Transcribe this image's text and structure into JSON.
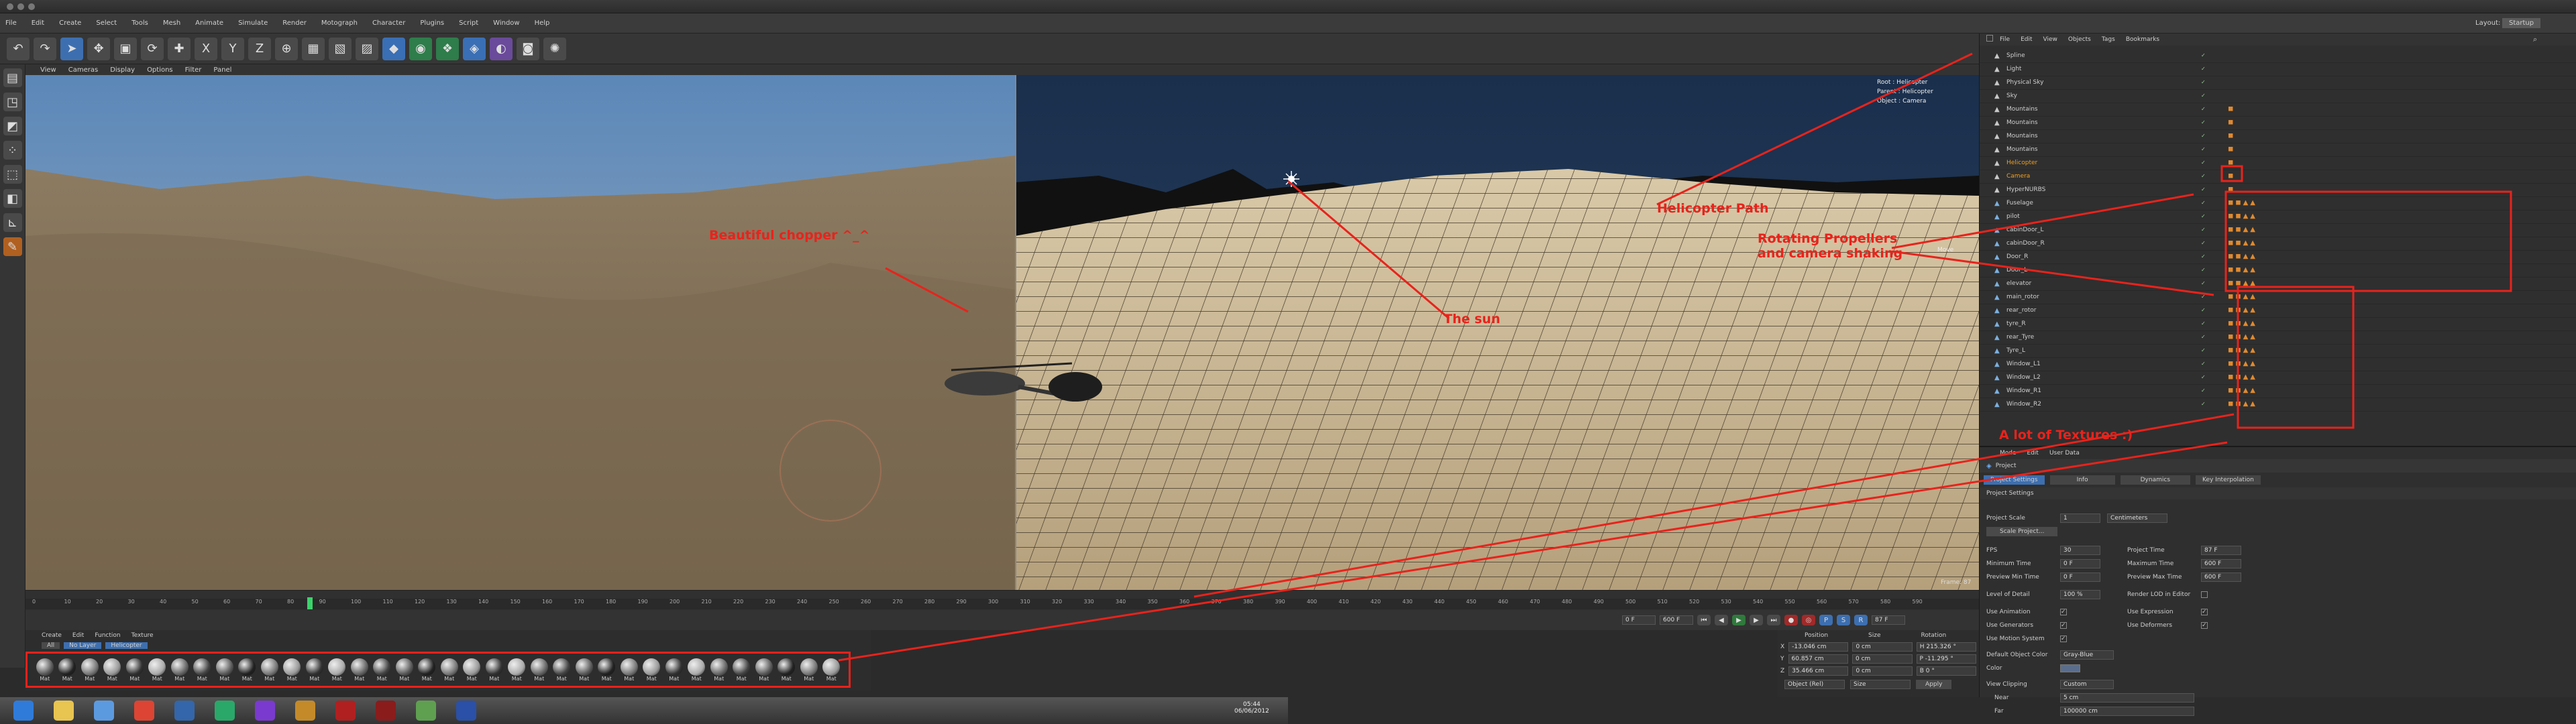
{
  "app": {
    "menu": [
      "File",
      "Edit",
      "Create",
      "Select",
      "Tools",
      "Mesh",
      "Animate",
      "Simulate",
      "Render",
      "Motograph",
      "Character",
      "Plugins",
      "Script",
      "Window",
      "Help"
    ],
    "layout_label": "Layout:",
    "layout_value": "Startup"
  },
  "viewport": {
    "menu": [
      "View",
      "Cameras",
      "Display",
      "Options",
      "Filter",
      "Panel"
    ],
    "hud": [
      "Root : Helicopter",
      "Parent : Helicopter",
      "Object : Camera"
    ],
    "hud_right": "Move",
    "frame_label": "Frame: 87"
  },
  "annotations": {
    "chopper": "Beautiful chopper ^_^",
    "sun": "The sun",
    "path": "Helicopter Path",
    "propellers": "Rotating Propellers\nand camera shaking",
    "textures": "A lot of Textures :)"
  },
  "objmgr": {
    "menu": [
      "File",
      "Edit",
      "View",
      "Objects",
      "Tags",
      "Bookmarks"
    ],
    "objects": [
      "Spline",
      "Light",
      "Physical Sky",
      "Sky",
      "Mountains",
      "Mountains",
      "Mountains",
      "Mountains",
      "Helicopter",
      "Camera",
      "HyperNURBS",
      "Fuselage",
      "pilot",
      "cabinDoor_L",
      "cabinDoor_R",
      "Door_R",
      "Door_L",
      "elevator",
      "main_rotor",
      "rear_rotor",
      "tyre_R",
      "rear_Tyre",
      "Tyre_L",
      "Window_L1",
      "Window_L2",
      "Window_R1",
      "Window_R2"
    ]
  },
  "attr": {
    "menu": [
      "Mode",
      "Edit",
      "User Data"
    ],
    "title": "Project",
    "tabs": [
      "Project Settings",
      "Info",
      "Dynamics",
      "Key Interpolation"
    ],
    "section": "Project Settings",
    "project_scale_label": "Project Scale",
    "project_scale_value": "1",
    "project_scale_unit": "Centimeters",
    "scale_btn": "Scale Project...",
    "fps_label": "FPS",
    "fps_value": "30",
    "project_time_label": "Project Time",
    "project_time_value": "87 F",
    "min_time_label": "Minimum Time",
    "min_time_value": "0 F",
    "max_time_label": "Maximum Time",
    "max_time_value": "600 F",
    "prev_min_label": "Preview Min Time",
    "prev_min_value": "0 F",
    "prev_max_label": "Preview Max Time",
    "prev_max_value": "600 F",
    "lod_label": "Level of Detail",
    "lod_value": "100 %",
    "render_lod_label": "Render LOD in Editor",
    "use_anim": "Use Animation",
    "use_expr": "Use Expression",
    "use_gen": "Use Generators",
    "use_def": "Use Deformers",
    "use_motion": "Use Motion System",
    "def_color_label": "Default Object Color",
    "def_color_value": "Gray-Blue",
    "color_label": "Color",
    "clip_label": "View Clipping",
    "clip_value": "Custom",
    "near_label": "Near",
    "near_value": "5 cm",
    "far_label": "Far",
    "far_value": "100000 cm"
  },
  "material": {
    "menu": [
      "Create",
      "Edit",
      "Function",
      "Texture"
    ],
    "filters": [
      "All",
      "No Layer",
      "Helicopter"
    ],
    "names": [
      "Mat",
      "Mat",
      "Mat",
      "Mat",
      "Mat",
      "Mat",
      "Mat",
      "Mat",
      "Mat",
      "Mat",
      "Mat",
      "Mat",
      "Mat",
      "Mat",
      "Mat",
      "Mat",
      "Mat",
      "Mat",
      "Mat",
      "Mat",
      "Mat",
      "Mat",
      "Mat",
      "Mat",
      "Mat",
      "Mat",
      "Mat",
      "Mat",
      "Mat",
      "Mat",
      "Mat",
      "Mat",
      "Mat",
      "Mat",
      "Mat",
      "Mat"
    ]
  },
  "timeline": {
    "ticks": [
      "0",
      "10",
      "20",
      "30",
      "40",
      "50",
      "60",
      "70",
      "80",
      "90",
      "100",
      "110",
      "120",
      "130",
      "140",
      "150",
      "160",
      "170",
      "180",
      "190",
      "200",
      "210",
      "220",
      "230",
      "240",
      "250",
      "260",
      "270",
      "280",
      "290",
      "300",
      "310",
      "320",
      "330",
      "340",
      "350",
      "360",
      "370",
      "380",
      "390",
      "400",
      "410",
      "420",
      "430",
      "440",
      "450",
      "460",
      "470",
      "480",
      "490",
      "500",
      "510",
      "520",
      "530",
      "540",
      "550",
      "560",
      "570",
      "580",
      "590"
    ],
    "current": "87 F",
    "start": "0 F",
    "end": "600 F",
    "end2": "600 F"
  },
  "coords": {
    "headers": [
      "Position",
      "Size",
      "Rotation"
    ],
    "rows": [
      {
        "axis": "X",
        "pos": "-13.046 cm",
        "size": "0 cm",
        "rot": "H 215.326 °"
      },
      {
        "axis": "Y",
        "pos": "60.857 cm",
        "size": "0 cm",
        "rot": "P -11.295 °"
      },
      {
        "axis": "Z",
        "pos": "35.466 cm",
        "size": "0 cm",
        "rot": "B 0 °"
      }
    ],
    "mode1": "Object (Rel)",
    "mode2": "Size",
    "apply": "Apply"
  },
  "taskbar": {
    "clock": "05:44",
    "date": "06/06/2012"
  },
  "colors": {
    "annot": "#e8231c",
    "accent": "#4a7bd0"
  }
}
